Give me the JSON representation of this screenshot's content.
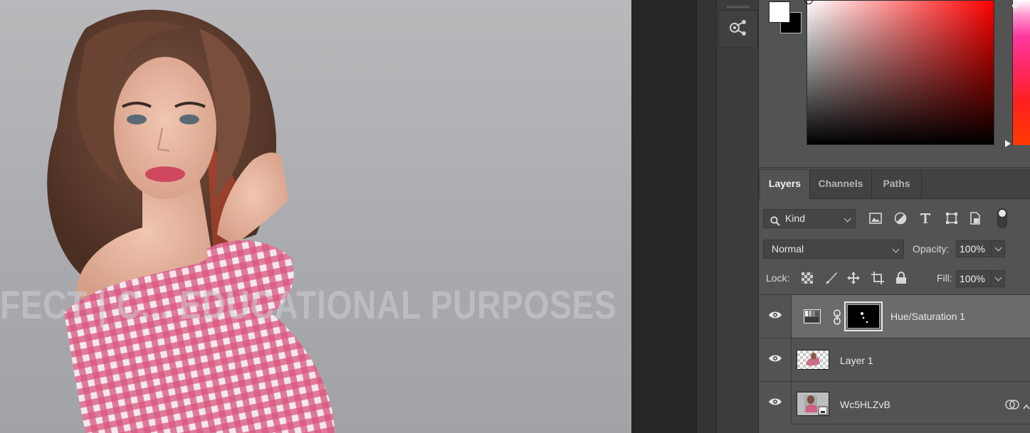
{
  "canvas": {
    "watermark_text": "FECT | C... EDUCATIONAL PURPOSES"
  },
  "strip": {
    "tool_icon": "share-network-icon"
  },
  "color_picker": {
    "foreground": "#ffffff",
    "background": "#000000",
    "hue": "#ff0000"
  },
  "layers_panel": {
    "tabs": [
      {
        "label": "Layers",
        "active": true
      },
      {
        "label": "Channels",
        "active": false
      },
      {
        "label": "Paths",
        "active": false
      }
    ],
    "filter_kind": "Kind",
    "blend_mode": "Normal",
    "opacity_label": "Opacity:",
    "opacity_value": "100%",
    "lock_label": "Lock:",
    "fill_label": "Fill:",
    "fill_value": "100%",
    "layers": [
      {
        "name": "Hue/Saturation 1",
        "type": "adjustment",
        "visible": true,
        "selected": true
      },
      {
        "name": "Layer 1",
        "type": "pixel",
        "visible": true,
        "selected": false
      },
      {
        "name": "Wc5HLZvB",
        "type": "smart-object",
        "visible": true,
        "selected": false
      }
    ]
  }
}
